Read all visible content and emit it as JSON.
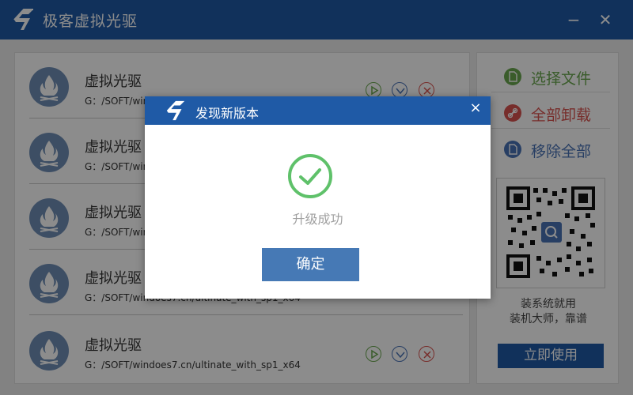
{
  "app": {
    "title": "极客虚拟光驱",
    "minimize_glyph": "−",
    "close_glyph": "✕",
    "brand_color": "#1f5aa6"
  },
  "drives": [
    {
      "name": "虚拟光驱",
      "path": "G：/SOFT/windoes7.cn/ultinate_with_sp1_x64"
    },
    {
      "name": "虚拟光驱",
      "path": "G：/SOFT/windoes7.cn/ultinate_with_sp1_x64"
    },
    {
      "name": "虚拟光驱",
      "path": "G：/SOFT/windoes7.cn/ultinate_with_sp1_x64"
    },
    {
      "name": "虚拟光驱",
      "path": "G：/SOFT/windoes7.cn/ultinate_with_sp1_x64"
    },
    {
      "name": "虚拟光驱",
      "path": "G：/SOFT/windoes7.cn/ultinate_with_sp1_x64"
    }
  ],
  "sidebar": {
    "select_file": {
      "label": "选择文件",
      "color": "#6aa84f",
      "icon": "file-icon"
    },
    "unmount_all": {
      "label": "全部卸载",
      "color": "#d9534f",
      "icon": "unlink-icon"
    },
    "remove_all": {
      "label": "移除全部",
      "color": "#4a73b6",
      "icon": "file-remove-icon"
    },
    "qr_line1": "装系统就用",
    "qr_line2": "装机大师，靠谱",
    "use_now": "立即使用"
  },
  "dialog": {
    "title": "发现新版本",
    "close_glyph": "×",
    "message": "升级成功",
    "ok_label": "确定",
    "success_color": "#5fc16a"
  }
}
